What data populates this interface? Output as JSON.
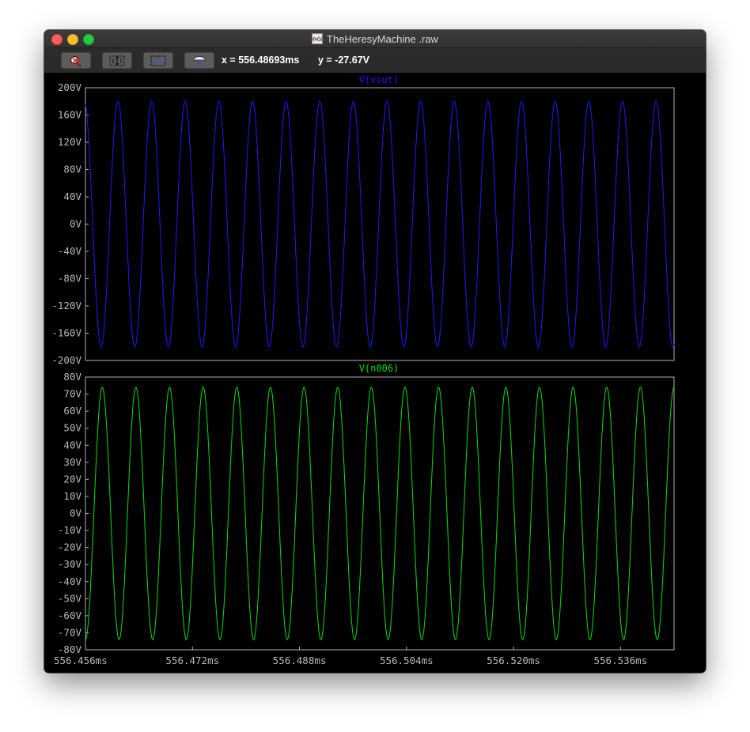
{
  "window": {
    "title": "TheHeresyMachine .raw"
  },
  "toolbar": {
    "buttons": [
      {
        "name": "zoom-button",
        "icon": "magnifier-cross-icon"
      },
      {
        "name": "autorange-y-button",
        "icon": "autorange-y-icon"
      },
      {
        "name": "autorange-x-button",
        "icon": "autorange-x-icon"
      },
      {
        "name": "probe-button",
        "icon": "hammer-probe-icon"
      }
    ],
    "cursor_x": "x = 556.48693ms",
    "cursor_y": "y = -27.67V"
  },
  "colors": {
    "vout": "#1a1aff",
    "n006": "#00e000",
    "grid_box": "#b0b0b0",
    "axis_text": "#b8b8b8"
  },
  "chart_data": [
    {
      "type": "line",
      "title": "V(vout)",
      "series": [
        {
          "name": "V(vout)",
          "amplitude": 180,
          "offset": 0,
          "cycles_in_view": 17.5,
          "start_value": 176,
          "start_direction": "falling",
          "end_value": -178
        }
      ],
      "yticks": [
        "200V",
        "160V",
        "120V",
        "80V",
        "40V",
        "0V",
        "-40V",
        "-80V",
        "-120V",
        "-160V",
        "-200V"
      ],
      "ylim": [
        -200,
        200
      ],
      "xlim": [
        556.456,
        556.544
      ]
    },
    {
      "type": "line",
      "title": "V(n006)",
      "series": [
        {
          "name": "V(n006)",
          "amplitude": 74,
          "offset": 0,
          "cycles_in_view": 17.5,
          "start_value": -74,
          "start_direction": "rising",
          "end_value": 74
        }
      ],
      "yticks": [
        "80V",
        "70V",
        "60V",
        "50V",
        "40V",
        "30V",
        "20V",
        "10V",
        "0V",
        "-10V",
        "-20V",
        "-30V",
        "-40V",
        "-50V",
        "-60V",
        "-70V",
        "-80V"
      ],
      "ylim": [
        -80,
        80
      ],
      "xticks": [
        "556.456ms",
        "556.472ms",
        "556.488ms",
        "556.504ms",
        "556.520ms",
        "556.536ms"
      ],
      "xtick_values": [
        556.456,
        556.472,
        556.488,
        556.504,
        556.52,
        556.536
      ],
      "xlim": [
        556.456,
        556.544
      ]
    }
  ]
}
